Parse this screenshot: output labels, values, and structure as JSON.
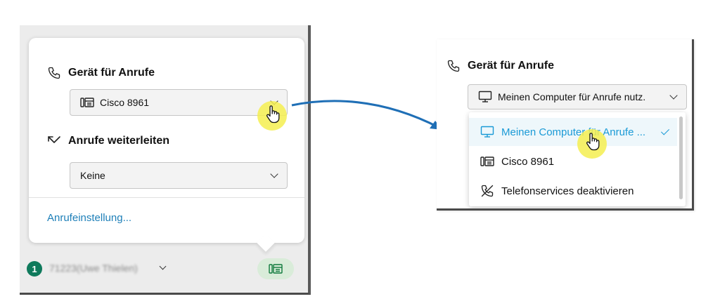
{
  "left_panel": {
    "call_device": {
      "title": "Gerät für Anrufe",
      "selected": "Cisco 8961"
    },
    "forward": {
      "title": "Anrufe weiterleiten",
      "selected": "Keine"
    },
    "settings_link": "Anrufeinstellung...",
    "footer": {
      "badge_count": "1",
      "user_name": "71223(Uwe Thielen)"
    }
  },
  "right_panel": {
    "title": "Gerät für Anrufe",
    "selected": "Meinen Computer für Anrufe nutz.",
    "options": [
      {
        "label": "Meinen Computer für Anrufe ...",
        "icon": "monitor-icon",
        "selected": true
      },
      {
        "label": "Cisco 8961",
        "icon": "desk-phone-icon",
        "selected": false
      },
      {
        "label": "Telefonservices deaktivieren",
        "icon": "phone-off-icon",
        "selected": false
      }
    ]
  },
  "colors": {
    "link": "#1d7fb8",
    "selected_item": "#1a9ad6",
    "arrow": "#1f6fb6",
    "badge": "#0f7a5c",
    "highlight": "#f5ee50"
  }
}
